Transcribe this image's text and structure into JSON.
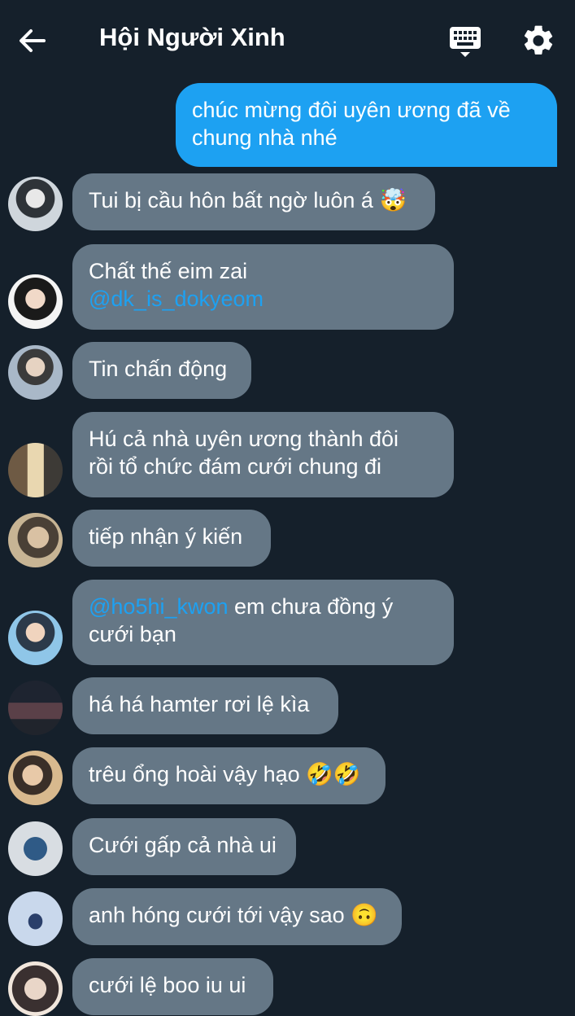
{
  "header": {
    "title": "Hội Người Xinh",
    "back_icon": "arrow-left-icon",
    "keyboard_icon": "keyboard-icon",
    "settings_icon": "gear-icon"
  },
  "messages": [
    {
      "from": "me",
      "lines": [
        "chúc mừng đôi uyên ương đã về",
        "chung nhà nhé"
      ]
    },
    {
      "from": "other",
      "text": "Tui bị cầu hôn bất ngờ luôn á",
      "emoji": "🤯"
    },
    {
      "from": "other",
      "line1": "Chất thế eim zai",
      "mention": "@dk_is_dokyeom"
    },
    {
      "from": "other",
      "text": "Tin chấn động"
    },
    {
      "from": "other",
      "lines": [
        "Hú cả nhà uyên ương thành đôi",
        "rồi tổ chức đám cưới chung đi"
      ]
    },
    {
      "from": "other",
      "text": "tiếp nhận ý kiến"
    },
    {
      "from": "other",
      "mention": "@ho5hi_kwon",
      "rest": " em chưa đồng ý",
      "line2": "cưới bạn"
    },
    {
      "from": "other",
      "text": "há há hamter rơi lệ kìa"
    },
    {
      "from": "other",
      "text": "trêu ổng hoài vậy hạo",
      "emoji": "🤣🤣"
    },
    {
      "from": "other",
      "text": "Cưới gấp cả nhà ui"
    },
    {
      "from": "other",
      "text": "anh hóng cưới tới vậy sao",
      "emoji": "🙃"
    },
    {
      "from": "other",
      "text": "cưới lệ  boo iu ui"
    }
  ],
  "colors": {
    "background": "#15202b",
    "outgoing_bubble": "#1da1f2",
    "incoming_bubble": "#657786",
    "mention": "#1da1f2"
  }
}
